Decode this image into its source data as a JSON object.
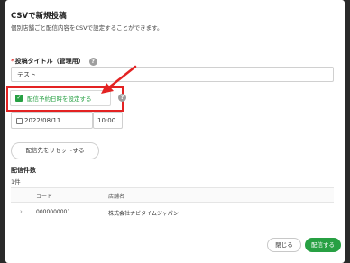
{
  "modal": {
    "title": "CSVで新規投稿",
    "subtitle": "個別店舗ごと配信内容をCSVで設定することができます。"
  },
  "post_title": {
    "required_mark": "*",
    "label": "投稿タイトル（管理用）",
    "value": "テスト"
  },
  "schedule": {
    "checkbox_label": "配信予約日時を設定する",
    "checked": true,
    "date": "2022/08/11",
    "time": "10:00"
  },
  "reset_label": "配信先をリセットする",
  "count": {
    "label": "配信件数",
    "value": "1件"
  },
  "table": {
    "headers": [
      "コード",
      "店舗名"
    ],
    "rows": [
      {
        "code": "0000000001",
        "name": "株式会社ナビタイムジャパン"
      }
    ]
  },
  "footer": {
    "close_label": "閉じる",
    "send_label": "配信する"
  },
  "colors": {
    "accent": "#27a043",
    "highlight": "#e32222"
  },
  "icons": {
    "help": "?",
    "check": "✓",
    "expand": "›"
  }
}
